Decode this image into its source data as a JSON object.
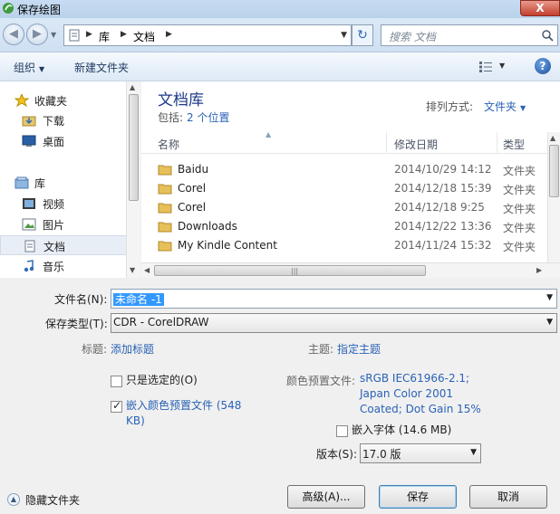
{
  "window": {
    "title": "保存绘图",
    "close_label": "X"
  },
  "nav": {
    "breadcrumbs": [
      "库",
      "文档"
    ],
    "search_placeholder": "搜索 文档"
  },
  "toolbar": {
    "organize": "组织",
    "new_folder": "新建文件夹",
    "help": "?"
  },
  "sidebar": {
    "items": [
      {
        "label": "收藏夹",
        "icon": "star-icon",
        "group": true
      },
      {
        "label": "下载",
        "icon": "download-folder-icon"
      },
      {
        "label": "桌面",
        "icon": "desktop-icon"
      },
      {
        "label": "库",
        "icon": "library-icon",
        "group": true
      },
      {
        "label": "视频",
        "icon": "video-library-icon"
      },
      {
        "label": "图片",
        "icon": "picture-library-icon"
      },
      {
        "label": "文档",
        "icon": "document-library-icon",
        "selected": true
      },
      {
        "label": "音乐",
        "icon": "music-library-icon"
      }
    ]
  },
  "library": {
    "title": "文档库",
    "includes_label": "包括:",
    "includes_value": "2 个位置",
    "arrange_label": "排列方式:",
    "arrange_value": "文件夹"
  },
  "columns": {
    "name": "名称",
    "modified": "修改日期",
    "type": "类型"
  },
  "files": [
    {
      "name": "Baidu",
      "date": "2014/10/29 14:12",
      "type": "文件夹"
    },
    {
      "name": "Corel",
      "date": "2014/12/18 15:39",
      "type": "文件夹"
    },
    {
      "name": "Corel",
      "date": "2014/12/18 9:25",
      "type": "文件夹"
    },
    {
      "name": "Downloads",
      "date": "2014/12/22 13:36",
      "type": "文件夹"
    },
    {
      "name": "My Kindle Content",
      "date": "2014/11/24 15:32",
      "type": "文件夹"
    }
  ],
  "form": {
    "filename_label": "文件名(N):",
    "filename_value": "未命名 -1",
    "filetype_label": "保存类型(T):",
    "filetype_value": "CDR - CorelDRAW",
    "title_label": "标题:",
    "title_link": "添加标题",
    "subject_label": "主题:",
    "subject_link": "指定主题",
    "only_selected": "只是选定的(O)",
    "embed_profile": "嵌入颜色预置文件 (548 KB)",
    "profile_label": "颜色预置文件:",
    "profile_value": "sRGB IEC61966-2.1; Japan Color 2001 Coated; Dot Gain 15%",
    "embed_fonts": "嵌入字体 (14.6 MB)",
    "version_label": "版本(S):",
    "version_value": "17.0 版",
    "hide_folders": "隐藏文件夹",
    "advanced_button": "高级(A)...",
    "save_button": "保存",
    "cancel_button": "取消",
    "only_selected_checked": false,
    "embed_profile_checked": true,
    "embed_fonts_checked": false
  },
  "colors": {
    "accent_link": "#2a62b6",
    "selection": "#3399ff",
    "library_title": "#1e3a8a"
  }
}
